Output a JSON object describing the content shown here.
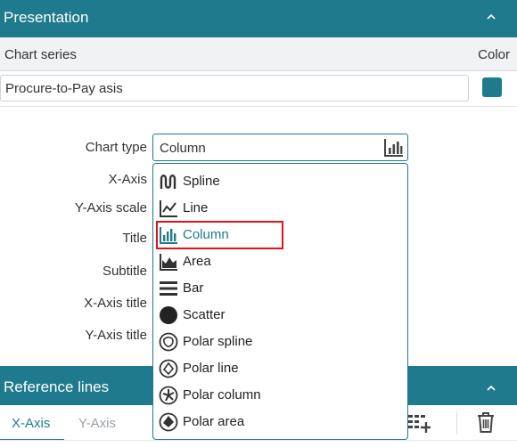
{
  "presentation": {
    "title": "Presentation",
    "series_header": "Chart series",
    "color_header": "Color",
    "series_name": "Procure-to-Pay asis",
    "series_color": "#1e7a8c"
  },
  "fields": {
    "chart_type": "Chart type",
    "x_axis": "X-Axis",
    "y_axis_scale": "Y-Axis scale",
    "title": "Title",
    "subtitle": "Subtitle",
    "x_axis_title": "X-Axis title",
    "y_axis_title": "Y-Axis title"
  },
  "chart_type_select": {
    "value": "Column",
    "icon": "column-chart-icon"
  },
  "dropdown": {
    "selected": "Column",
    "options": [
      {
        "label": "Spline",
        "icon": "spline-chart-icon"
      },
      {
        "label": "Line",
        "icon": "line-chart-icon"
      },
      {
        "label": "Column",
        "icon": "column-chart-icon"
      },
      {
        "label": "Area",
        "icon": "area-chart-icon"
      },
      {
        "label": "Bar",
        "icon": "bar-chart-icon"
      },
      {
        "label": "Scatter",
        "icon": "scatter-chart-icon"
      },
      {
        "label": "Polar spline",
        "icon": "polar-spline-icon"
      },
      {
        "label": "Polar line",
        "icon": "polar-line-icon"
      },
      {
        "label": "Polar column",
        "icon": "polar-column-icon"
      },
      {
        "label": "Polar area",
        "icon": "polar-area-icon"
      }
    ]
  },
  "reference_lines": {
    "title": "Reference lines",
    "tabs": [
      "X-Axis",
      "Y-Axis"
    ],
    "active_tab": "X-Axis",
    "add_icon": "add-reference-line-icon",
    "delete_icon": "trash-icon"
  },
  "colors": {
    "accent": "#1e7a8c",
    "highlight": "#e0121b"
  }
}
